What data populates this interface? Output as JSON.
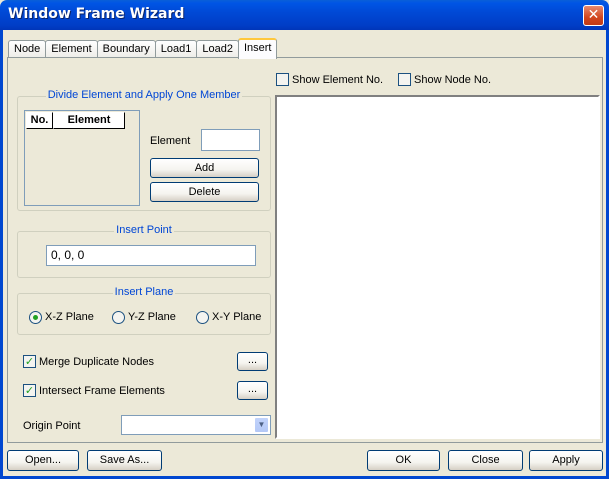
{
  "window": {
    "title": "Window Frame Wizard",
    "close_glyph": "✕"
  },
  "tabs": [
    {
      "label": "Node"
    },
    {
      "label": "Element"
    },
    {
      "label": "Boundary"
    },
    {
      "label": "Load1"
    },
    {
      "label": "Load2"
    },
    {
      "label": "Insert",
      "active": true
    }
  ],
  "divide": {
    "title": "Divide Element and Apply One Member",
    "col_no": "No.",
    "col_element": "Element",
    "element_label": "Element",
    "element_value": "",
    "add_label": "Add",
    "delete_label": "Delete"
  },
  "insert_point": {
    "title": "Insert Point",
    "value": "0, 0, 0"
  },
  "insert_plane": {
    "title": "Insert Plane",
    "options": [
      {
        "label": "X-Z Plane",
        "selected": true
      },
      {
        "label": "Y-Z Plane",
        "selected": false
      },
      {
        "label": "X-Y Plane",
        "selected": false
      }
    ]
  },
  "merge": {
    "label": "Merge Duplicate Nodes",
    "checked": true,
    "more": "..."
  },
  "intersect": {
    "label": "Intersect Frame Elements",
    "checked": true,
    "more": "..."
  },
  "origin": {
    "label": "Origin Point",
    "value": ""
  },
  "view": {
    "show_element_label": "Show Element No.",
    "show_element_checked": false,
    "show_node_label": "Show Node No.",
    "show_node_checked": false
  },
  "footer": {
    "open_label": "Open...",
    "save_as_label": "Save As...",
    "ok_label": "OK",
    "close_label": "Close",
    "apply_label": "Apply"
  },
  "icons": {
    "dropdown": "chevron-down-icon",
    "close": "close-icon",
    "check": "checkmark-icon"
  },
  "colors": {
    "title_bar": "#0049D6",
    "group_title": "#0046D5",
    "window_bg": "#ECE9D8",
    "check_mark": "#21A121"
  }
}
